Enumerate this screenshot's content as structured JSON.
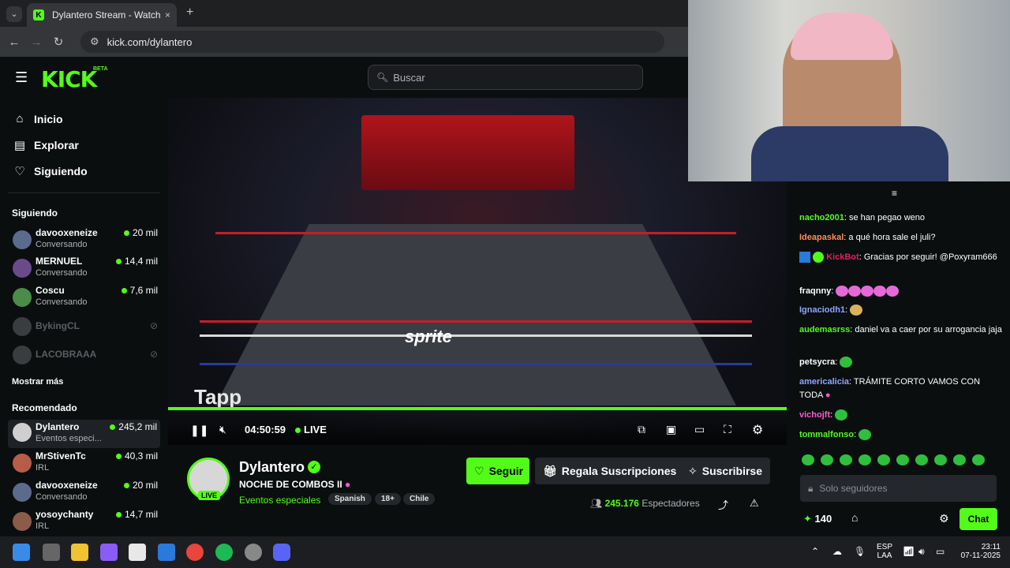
{
  "browser": {
    "tab_title": "Dylantero Stream - Watch Live",
    "tab_close": "×",
    "new_tab": "+",
    "url": "kick.com/dylantero"
  },
  "header": {
    "logo": "KICK",
    "beta": "BETA",
    "search_placeholder": "Buscar"
  },
  "nav": [
    {
      "label": "Inicio",
      "icon": "home-icon"
    },
    {
      "label": "Explorar",
      "icon": "browse-icon"
    },
    {
      "label": "Siguiendo",
      "icon": "heart-icon"
    }
  ],
  "following": {
    "title": "Siguiendo",
    "more": "Mostrar más",
    "channels": [
      {
        "name": "davooxeneize",
        "sub": "Conversando",
        "viewers": "20 mil",
        "live": true
      },
      {
        "name": "MERNUEL",
        "sub": "Conversando",
        "viewers": "14,4 mil",
        "live": true
      },
      {
        "name": "Coscu",
        "sub": "Conversando",
        "viewers": "7,6 mil",
        "live": true
      },
      {
        "name": "BykingCL",
        "sub": "",
        "viewers": "",
        "live": false
      },
      {
        "name": "LACOBRAAA",
        "sub": "",
        "viewers": "",
        "live": false
      }
    ]
  },
  "recommended": {
    "title": "Recomendado",
    "channels": [
      {
        "name": "Dylantero",
        "sub": "Eventos especi...",
        "viewers": "245,2 mil"
      },
      {
        "name": "MrStivenTc",
        "sub": "IRL",
        "viewers": "40,3 mil"
      },
      {
        "name": "davooxeneize",
        "sub": "Conversando",
        "viewers": "20 mil"
      },
      {
        "name": "yosoychanty",
        "sub": "IRL",
        "viewers": "14,7 mil"
      }
    ]
  },
  "player": {
    "time": "04:50:59",
    "live": "LIVE",
    "watermark": "Tapp",
    "progress": 1.0
  },
  "stream": {
    "name": "Dylantero",
    "title": "NOCHE DE COMBOS II",
    "category": "Eventos especiales",
    "tags": [
      "Spanish",
      "18+",
      "Chile"
    ],
    "live_badge": "LIVE",
    "follow": "Seguir",
    "gift": "Regala Suscripciones",
    "subscribe": "Suscribirse",
    "viewers": "245.176",
    "viewers_label": "Espectadores"
  },
  "chat": {
    "messages": [
      {
        "user": "nacho2001",
        "text": "se han pegao weno",
        "color": "#53fc18"
      },
      {
        "user": "Ideapaskal",
        "text": "a qué hora sale el juli?",
        "color": "#ff8c5a"
      },
      {
        "user": "KickBot",
        "text": "Gracias por seguir! @Poxyram666",
        "color": "#e61e5c"
      },
      {
        "user": "fraqnny",
        "text": "",
        "color": "#ffffff"
      },
      {
        "user": "Ignaciodh1",
        "text": "",
        "color": "#8fa6ff"
      },
      {
        "user": "audemasrss",
        "text": "daniel va a caer por su arrogancia jaja",
        "color": "#53fc18"
      },
      {
        "user": "petsycra",
        "text": "",
        "color": "#ffffff"
      },
      {
        "user": "americalicia",
        "text": "TRÁMITE CORTO VAMOS CON TODA",
        "color": "#8fa6ff"
      },
      {
        "user": "vichojft",
        "text": "",
        "color": "#ff5ad0"
      },
      {
        "user": "tommalfonso",
        "text": "",
        "color": "#53fc18"
      }
    ],
    "input_placeholder": "Solo seguidores",
    "points": "140",
    "chat_button": "Chat"
  },
  "taskbar": {
    "lang": "ESP",
    "lang2": "LAA",
    "time": "23:11",
    "date": "07-11-2025"
  }
}
